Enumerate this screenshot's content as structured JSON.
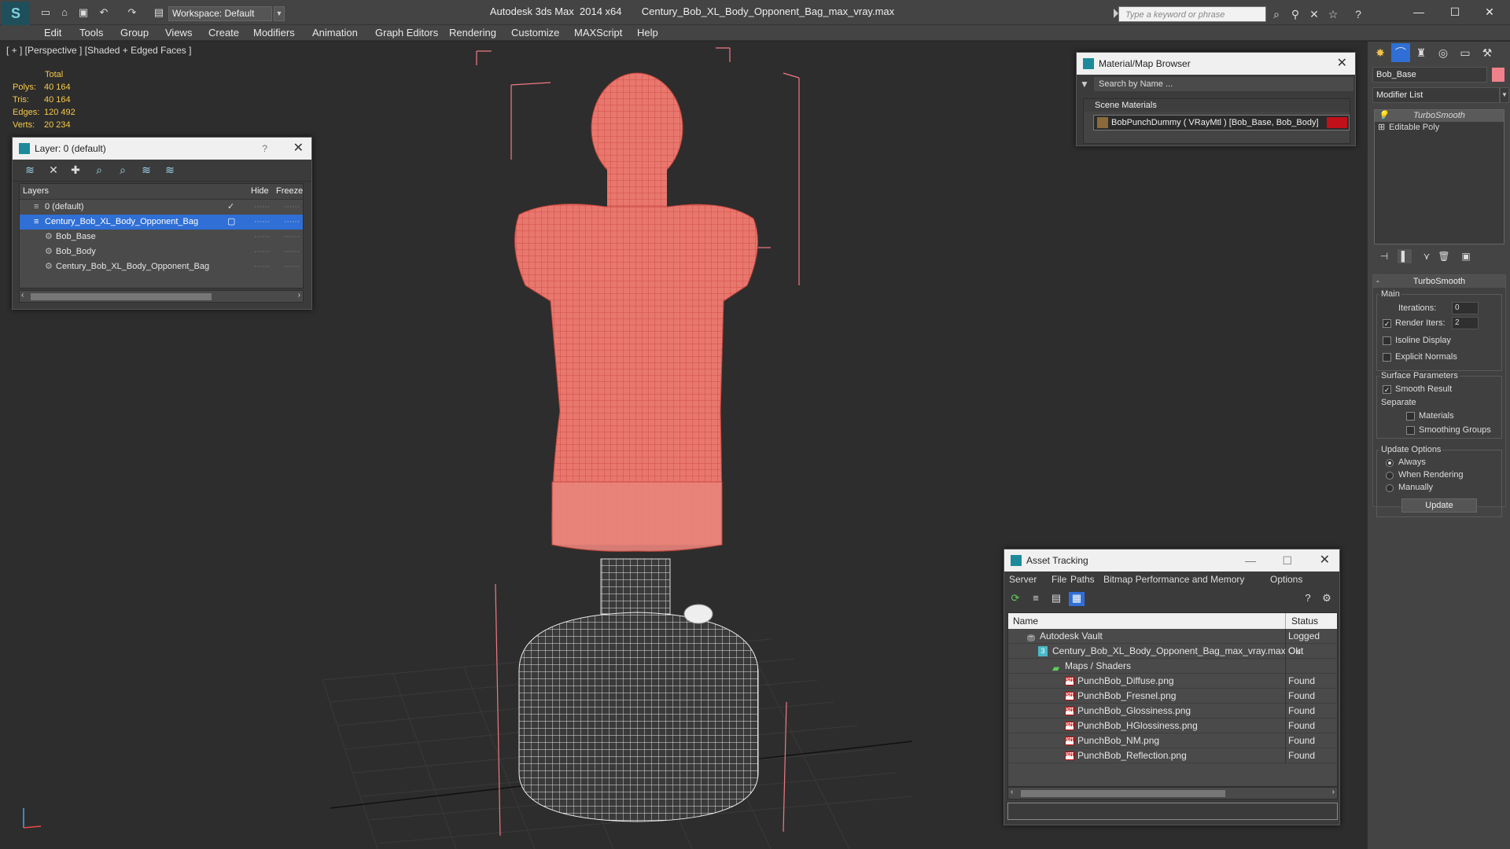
{
  "titlebar": {
    "workspace": "Workspace: Default",
    "window_title": "Autodesk 3ds Max  2014 x64       Century_Bob_XL_Body_Opponent_Bag_max_vray.max",
    "search_placeholder": "Type a keyword or phrase"
  },
  "menu": {
    "items": [
      "Edit",
      "Tools",
      "Group",
      "Views",
      "Create",
      "Modifiers",
      "Animation",
      "Graph Editors",
      "Rendering",
      "Customize",
      "MAXScript",
      "Help"
    ]
  },
  "viewport": {
    "label": "[ + ] [Perspective ] [Shaded + Edged Faces ]",
    "stats_header": "Total",
    "stats": [
      {
        "key": "Polys:",
        "value": "40 164"
      },
      {
        "key": "Tris:",
        "value": "40 164"
      },
      {
        "key": "Edges:",
        "value": "120 492"
      },
      {
        "key": "Verts:",
        "value": "20 234"
      }
    ]
  },
  "layer_window": {
    "title": "Layer: 0 (default)",
    "help": "?",
    "columns": {
      "layers": "Layers",
      "hide": "Hide",
      "freeze": "Freeze"
    },
    "rows": [
      {
        "label": "0 (default)",
        "indent": 1
      },
      {
        "label": "Century_Bob_XL_Body_Opponent_Bag",
        "indent": 1,
        "selected": true
      },
      {
        "label": "Bob_Base",
        "indent": 2
      },
      {
        "label": "Bob_Body",
        "indent": 2
      },
      {
        "label": "Century_Bob_XL_Body_Opponent_Bag",
        "indent": 2
      }
    ]
  },
  "material_browser": {
    "title": "Material/Map Browser",
    "search": "Search by Name ...",
    "section": "Scene Materials",
    "material": "BobPunchDummy  ( VRayMtl ) [Bob_Base, Bob_Body]",
    "swatch_color": "#c0101a"
  },
  "asset_tracking": {
    "title": "Asset Tracking",
    "menu": [
      "Server",
      "File",
      "Paths",
      "Bitmap Performance and Memory",
      "Options"
    ],
    "columns": {
      "name": "Name",
      "status": "Status"
    },
    "rows": [
      {
        "name": "Autodesk Vault",
        "status": "Logged Out",
        "indent": 1,
        "icon": "vault-icon"
      },
      {
        "name": "Century_Bob_XL_Body_Opponent_Bag_max_vray.max",
        "status": "Ok",
        "indent": 2,
        "icon": "max-file-icon"
      },
      {
        "name": "Maps / Shaders",
        "status": "",
        "indent": 3,
        "icon": "maps-folder-icon"
      },
      {
        "name": "PunchBob_Diffuse.png",
        "status": "Found",
        "indent": 4,
        "icon": "png-icon"
      },
      {
        "name": "PunchBob_Fresnel.png",
        "status": "Found",
        "indent": 4,
        "icon": "png-icon"
      },
      {
        "name": "PunchBob_Glossiness.png",
        "status": "Found",
        "indent": 4,
        "icon": "png-icon"
      },
      {
        "name": "PunchBob_HGlossiness.png",
        "status": "Found",
        "indent": 4,
        "icon": "png-icon"
      },
      {
        "name": "PunchBob_NM.png",
        "status": "Found",
        "indent": 4,
        "icon": "png-icon"
      },
      {
        "name": "PunchBob_Reflection.png",
        "status": "Found",
        "indent": 4,
        "icon": "png-icon"
      }
    ]
  },
  "command_panel": {
    "object_name": "Bob_Base",
    "object_color": "#f0808a",
    "modifier_list": "Modifier List",
    "stack": [
      "TurboSmooth",
      "Editable Poly"
    ],
    "rollout": {
      "title": "TurboSmooth",
      "main": "Main",
      "iterations_label": "Iterations:",
      "iterations": "0",
      "render_iters_label": "Render Iters:",
      "render_iters": "2",
      "isoline": "Isoline Display",
      "explicit_normals": "Explicit Normals",
      "surface_params": "Surface Parameters",
      "smooth_result": "Smooth Result",
      "separate": "Separate",
      "materials": "Materials",
      "smoothing_groups": "Smoothing Groups",
      "update_options": "Update Options",
      "always": "Always",
      "when_rendering": "When Rendering",
      "manually": "Manually",
      "update_button": "Update"
    }
  }
}
